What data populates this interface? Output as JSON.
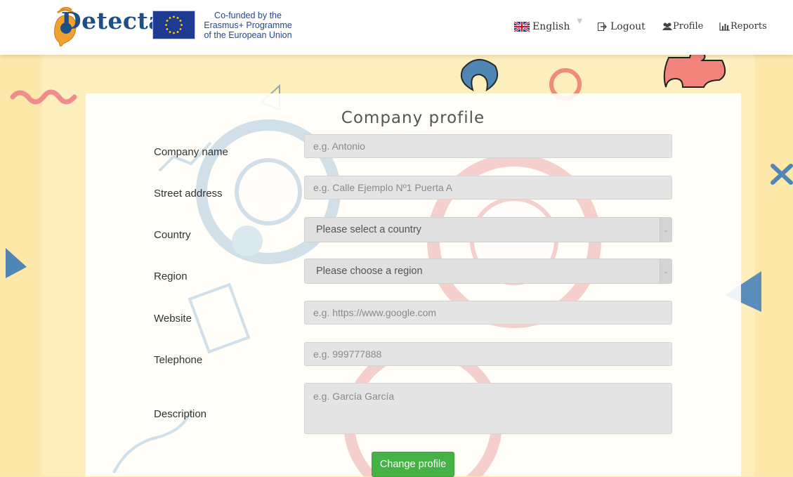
{
  "header": {
    "logo_text": "Detecta",
    "eu_text_line1": "Co-funded by the",
    "eu_text_line2": "Erasmus+ Programme",
    "eu_text_line3": "of the European Union",
    "nav": {
      "language": "English",
      "logout": "Logout",
      "profile": "Profile",
      "reports": "Reports"
    }
  },
  "form": {
    "title": "Company profile",
    "fields": {
      "company_name": {
        "label": "Company name",
        "placeholder": "e.g. Antonio"
      },
      "street_address": {
        "label": "Street address",
        "placeholder": "e.g. Calle Ejemplo Nº1 Puerta A"
      },
      "country": {
        "label": "Country",
        "value": "Please select a country"
      },
      "region": {
        "label": "Region",
        "value": "Please choose a region"
      },
      "website": {
        "label": "Website",
        "placeholder": "e.g. https://www.google.com"
      },
      "telephone": {
        "label": "Telephone",
        "placeholder": "e.g. 999777888"
      },
      "description": {
        "label": "Description",
        "placeholder": "e.g. García García"
      }
    },
    "submit_label": "Change profile"
  },
  "colors": {
    "background": "#fde9b0",
    "brand_blue": "#1d4f86",
    "button_green": "#44b244",
    "eu_blue": "#1f3a93"
  }
}
